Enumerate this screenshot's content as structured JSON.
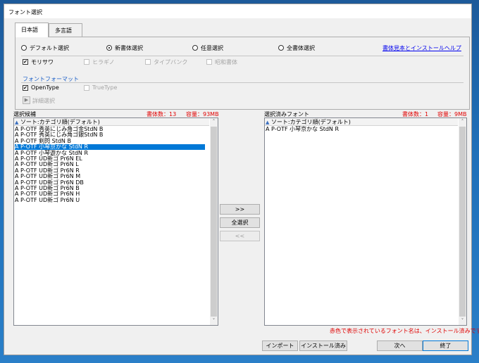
{
  "window": {
    "title": "フォント選択"
  },
  "tabs": [
    {
      "label": "日本語",
      "active": true
    },
    {
      "label": "多言語",
      "active": false
    }
  ],
  "font_type_radios": [
    {
      "label": "デフォルト選択",
      "selected": false
    },
    {
      "label": "新書体選択",
      "selected": true
    },
    {
      "label": "任意選択",
      "selected": false
    },
    {
      "label": "全書体選択",
      "selected": false
    }
  ],
  "help_link": "書体見本とインストールヘルプ",
  "family_checks": [
    {
      "label": "モリサワ",
      "checked": true,
      "enabled": true
    },
    {
      "label": "ヒラギノ",
      "checked": false,
      "enabled": false
    },
    {
      "label": "タイプバンク",
      "checked": false,
      "enabled": false
    },
    {
      "label": "昭和書体",
      "checked": false,
      "enabled": false
    }
  ],
  "font_format": {
    "title": "フォントフォーマット",
    "options": [
      {
        "label": "OpenType",
        "checked": true,
        "enabled": true
      },
      {
        "label": "TrueType",
        "checked": false,
        "enabled": false
      }
    ]
  },
  "detail_select": {
    "label": "詳細選択",
    "icon": "play-icon"
  },
  "left_panel": {
    "title": "選択候補",
    "count": "書体数：13",
    "size": "容量：93MB",
    "column_header": "ソート:カテゴリ順(デフォルト)",
    "items": [
      {
        "text": "A P-OTF 秀英にじみ角ゴ金StdN B",
        "selected": false
      },
      {
        "text": "A P-OTF 秀英にじみ角ゴ銀StdN B",
        "selected": false
      },
      {
        "text": "A P-OTF 剣閃 StdN B",
        "selected": false
      },
      {
        "text": "A P-OTF 小琴京かな StdN R",
        "selected": true
      },
      {
        "text": "A P-OTF 小琴遊かな StdN R",
        "selected": false
      },
      {
        "text": "A P-OTF UD新ゴ Pr6N EL",
        "selected": false
      },
      {
        "text": "A P-OTF UD新ゴ Pr6N L",
        "selected": false
      },
      {
        "text": "A P-OTF UD新ゴ Pr6N R",
        "selected": false
      },
      {
        "text": "A P-OTF UD新ゴ Pr6N M",
        "selected": false
      },
      {
        "text": "A P-OTF UD新ゴ Pr6N DB",
        "selected": false
      },
      {
        "text": "A P-OTF UD新ゴ Pr6N B",
        "selected": false
      },
      {
        "text": "A P-OTF UD新ゴ Pr6N H",
        "selected": false
      },
      {
        "text": "A P-OTF UD新ゴ Pr6N U",
        "selected": false
      }
    ]
  },
  "middle_buttons": {
    "add": ">>",
    "select_all": "全選択",
    "remove": "<<"
  },
  "right_panel": {
    "title": "選択済みフォント",
    "count": "書体数：1",
    "size": "容量：9MB",
    "column_header": "ソート:カテゴリ順(デフォルト)",
    "items": [
      {
        "text": "A P-OTF 小琴京かな StdN R",
        "selected": false
      }
    ]
  },
  "notice": "赤色で表示されているフォント名は、インストール済みです。",
  "footer_buttons": {
    "import": "インポート",
    "install_only": "インストール済み",
    "next": "次へ",
    "finish": "終了"
  },
  "colors": {
    "accent": "#0078d7",
    "installed_red": "#e00000",
    "link_blue": "#0000ee"
  }
}
